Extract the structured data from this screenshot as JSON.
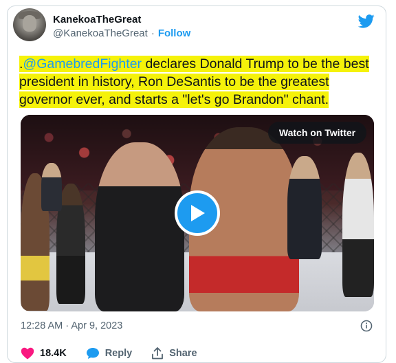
{
  "author": {
    "name": "KanekoaTheGreat",
    "handle": "@KanekoaTheGreat",
    "separator": "·",
    "follow_label": "Follow"
  },
  "tweet": {
    "prefix": ".",
    "mention": "@GamebredFighter",
    "text": " declares Donald Trump to be the best president in history, Ron DeSantis to be the greatest governor ever, and starts a \"let's go Brandon\" chant.",
    "highlight_color": "#f5f20a"
  },
  "media": {
    "watch_label": "Watch on Twitter",
    "play_icon": "play-icon"
  },
  "meta": {
    "timestamp": "12:28 AM · Apr 9, 2023"
  },
  "actions": {
    "likes": "18.4K",
    "reply_label": "Reply",
    "share_label": "Share"
  },
  "colors": {
    "brand_blue": "#1d9bf0",
    "like_pink": "#f91880",
    "text_secondary": "#536471"
  }
}
